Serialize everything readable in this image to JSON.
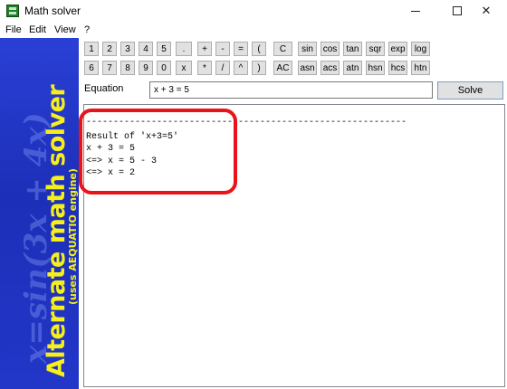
{
  "window": {
    "title": "Math solver",
    "app_icon": "calculator-icon",
    "controls": {
      "minimize": "minimize-icon",
      "maximize": "maximize-icon",
      "close": "✕"
    }
  },
  "menu": {
    "items": [
      "File",
      "Edit",
      "View",
      "?"
    ]
  },
  "banner": {
    "title": "Alternate math solver",
    "subtitle": "(uses AEQUATIO engine)",
    "background_text": "x=sin(3x + 4x)",
    "title_color": "#f6ef1a",
    "background_color": "#2236c8"
  },
  "keypad": {
    "row1": [
      "1",
      "2",
      "3",
      "4",
      "5",
      ".",
      "+",
      "-",
      "=",
      "(",
      "C",
      "sin",
      "cos",
      "tan",
      "sqr",
      "exp",
      "log"
    ],
    "row2": [
      "6",
      "7",
      "8",
      "9",
      "0",
      "x",
      "*",
      "/",
      "^",
      ")",
      "AC",
      "asn",
      "acs",
      "atn",
      "hsn",
      "hcs",
      "htn"
    ]
  },
  "equation": {
    "label": "Equation",
    "value": "x + 3 = 5",
    "solve_label": "Solve"
  },
  "output": {
    "lines": [
      "-----------------------------------------------------------",
      "Result of 'x+3=5'",
      "x + 3 = 5",
      "<=> x = 5 - 3",
      "<=> x = 2"
    ],
    "highlight_color": "#e8141a"
  }
}
